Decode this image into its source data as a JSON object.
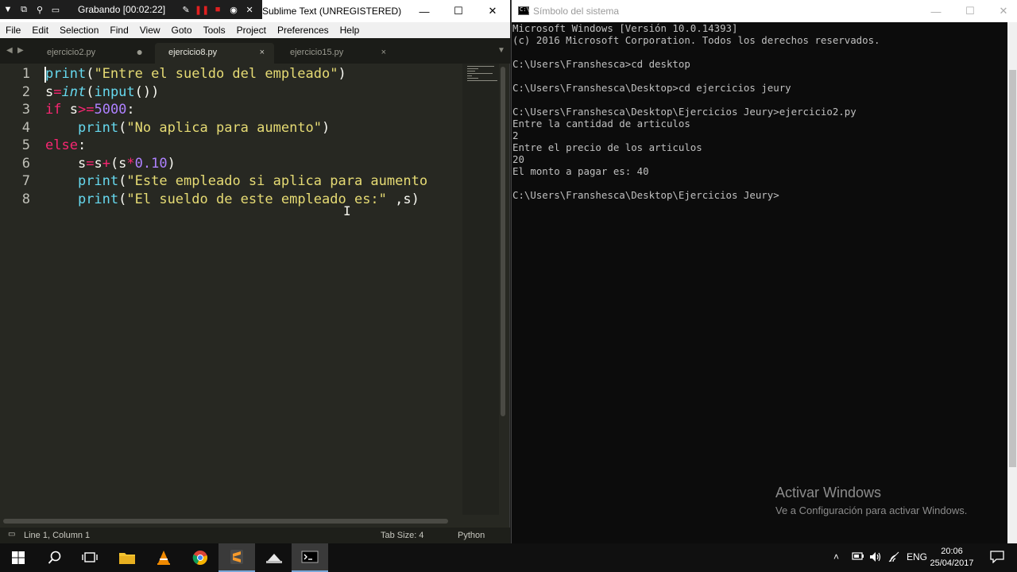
{
  "recorder": {
    "label": "Grabando [00:02:22]"
  },
  "sublime": {
    "title": "Sublime Text (UNREGISTERED)",
    "menu": [
      "File",
      "Edit",
      "Selection",
      "Find",
      "View",
      "Goto",
      "Tools",
      "Project",
      "Preferences",
      "Help"
    ],
    "tabs": [
      {
        "label": "ejercicio2.py",
        "state": "modified"
      },
      {
        "label": "ejercicio8.py",
        "state": "active"
      },
      {
        "label": "ejercicio15.py",
        "state": "normal"
      }
    ],
    "line_numbers": [
      "1",
      "2",
      "3",
      "4",
      "5",
      "6",
      "7",
      "8"
    ],
    "code": [
      "print(\"Entre el sueldo del empleado\")",
      "s=int(input())",
      "if s>=5000:",
      "    print(\"No aplica para aumento\")",
      "else:",
      "    s=s+(s*0.10)",
      "    print(\"Este empleado si aplica para aumento",
      "    print(\"El sueldo de este empleado es:\" ,s)"
    ],
    "status": {
      "position": "Line 1, Column 1",
      "tab_size": "Tab Size: 4",
      "syntax": "Python"
    },
    "colors": {
      "background": "#272822",
      "keyword": "#f92672",
      "function": "#66d9ef",
      "string": "#e6db74",
      "number": "#ae81ff"
    }
  },
  "cmd": {
    "title": "Símbolo del sistema",
    "lines": [
      "Microsoft Windows [Versión 10.0.14393]",
      "(c) 2016 Microsoft Corporation. Todos los derechos reservados.",
      "",
      "C:\\Users\\Franshesca>cd desktop",
      "",
      "C:\\Users\\Franshesca\\Desktop>cd ejercicios jeury",
      "",
      "C:\\Users\\Franshesca\\Desktop\\Ejercicios Jeury>ejercicio2.py",
      "Entre la cantidad de articulos",
      "2",
      "Entre el precio de los articulos",
      "20",
      "El monto a pagar es: 40",
      "",
      "C:\\Users\\Franshesca\\Desktop\\Ejercicios Jeury>"
    ]
  },
  "watermark": {
    "title": "Activar Windows",
    "subtitle": "Ve a Configuración para activar Windows."
  },
  "taskbar": {
    "apps": [
      "windows-start",
      "search",
      "task-view",
      "file-explorer",
      "vlc",
      "chrome",
      "sublime-text",
      "cloud-app",
      "command-prompt"
    ],
    "language": "ENG",
    "time": "20:06",
    "date": "25/04/2017"
  }
}
